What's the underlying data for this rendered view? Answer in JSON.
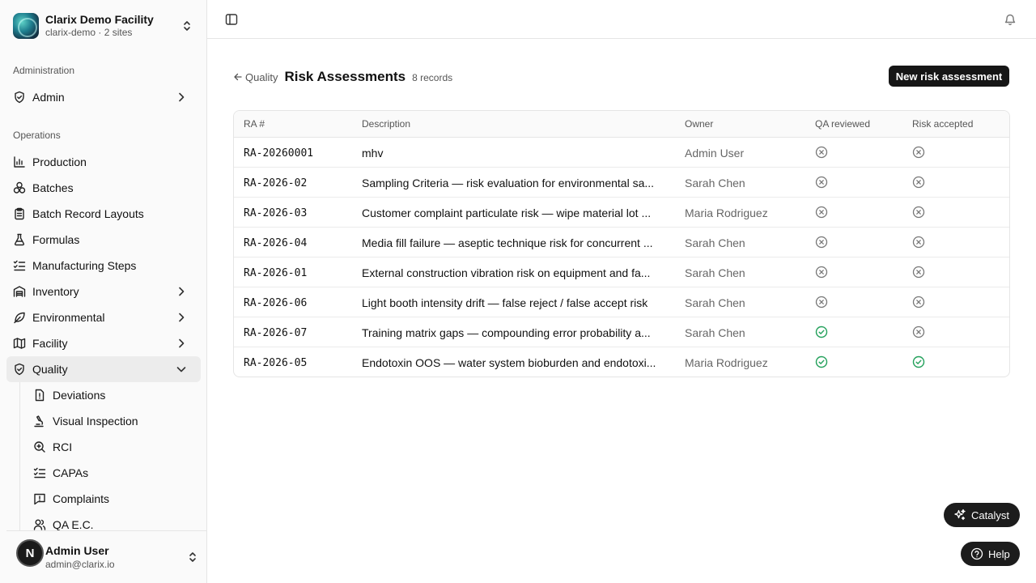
{
  "org": {
    "name": "Clarix Demo Facility",
    "slug": "clarix-demo",
    "sites": "· 2 sites"
  },
  "groups": {
    "administration": "Administration",
    "operations": "Operations"
  },
  "nav": {
    "admin": "Admin",
    "production": "Production",
    "batches": "Batches",
    "batch_record_layouts": "Batch Record Layouts",
    "formulas": "Formulas",
    "manufacturing_steps": "Manufacturing Steps",
    "inventory": "Inventory",
    "environmental": "Environmental",
    "facility": "Facility",
    "quality": "Quality"
  },
  "quality_sub": {
    "deviations": "Deviations",
    "visual_inspection": "Visual Inspection",
    "rci": "RCI",
    "capas": "CAPAs",
    "complaints": "Complaints",
    "qa_ec": "QA E.C."
  },
  "user": {
    "name": "Admin User",
    "email": "admin@clarix.io",
    "initial": "N"
  },
  "page": {
    "back_label": "Quality",
    "title": "Risk Assessments",
    "record_count": "8 records",
    "new_button": "New risk assessment"
  },
  "table": {
    "headers": {
      "ra": "RA #",
      "description": "Description",
      "owner": "Owner",
      "qa": "QA reviewed",
      "risk": "Risk accepted"
    },
    "rows": [
      {
        "ra": "RA-20260001",
        "description": "mhv",
        "owner": "Admin User",
        "qa_reviewed": false,
        "risk_accepted": false
      },
      {
        "ra": "RA-2026-02",
        "description": "Sampling Criteria — risk evaluation for environmental sa...",
        "owner": "Sarah Chen",
        "qa_reviewed": false,
        "risk_accepted": false
      },
      {
        "ra": "RA-2026-03",
        "description": "Customer complaint particulate risk — wipe material lot ...",
        "owner": "Maria Rodriguez",
        "qa_reviewed": false,
        "risk_accepted": false
      },
      {
        "ra": "RA-2026-04",
        "description": "Media fill failure — aseptic technique risk for concurrent ...",
        "owner": "Sarah Chen",
        "qa_reviewed": false,
        "risk_accepted": false
      },
      {
        "ra": "RA-2026-01",
        "description": "External construction vibration risk on equipment and fa...",
        "owner": "Sarah Chen",
        "qa_reviewed": false,
        "risk_accepted": false
      },
      {
        "ra": "RA-2026-06",
        "description": "Light booth intensity drift — false reject / false accept risk",
        "owner": "Sarah Chen",
        "qa_reviewed": false,
        "risk_accepted": false
      },
      {
        "ra": "RA-2026-07",
        "description": "Training matrix gaps — compounding error probability a...",
        "owner": "Sarah Chen",
        "qa_reviewed": true,
        "risk_accepted": false
      },
      {
        "ra": "RA-2026-05",
        "description": "Endotoxin OOS — water system bioburden and endotoxi...",
        "owner": "Maria Rodriguez",
        "qa_reviewed": true,
        "risk_accepted": true
      }
    ]
  },
  "floating": {
    "catalyst": "Catalyst",
    "help": "Help"
  },
  "colors": {
    "check_green": "#22a05a",
    "x_gray": "#777777",
    "button_dark": "#161616"
  }
}
